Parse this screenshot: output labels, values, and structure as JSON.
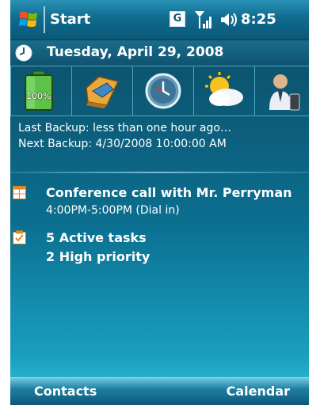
{
  "titlebar": {
    "start_label": "Start",
    "network_indicator": "G",
    "time": "8:25",
    "icons": [
      "windows-flag-icon",
      "signal-strength-icon",
      "volume-icon"
    ]
  },
  "today": {
    "date": "Tuesday, April 29, 2008"
  },
  "tiles": [
    {
      "name": "battery-icon",
      "label": "100%"
    },
    {
      "name": "folder-icon"
    },
    {
      "name": "clock-icon"
    },
    {
      "name": "weather-icon"
    },
    {
      "name": "contact-icon"
    }
  ],
  "backup": {
    "last": "Last Backup:  less than one hour ago…",
    "next": "Next Backup: 4/30/2008 10:00:00 AM"
  },
  "appointment": {
    "title": "Conference call with Mr. Perryman",
    "detail": "4:00PM-5:00PM (Dial in)"
  },
  "tasks": {
    "active": "5 Active tasks",
    "priority": "2 High priority"
  },
  "softkeys": {
    "left": "Contacts",
    "right": "Calendar"
  }
}
